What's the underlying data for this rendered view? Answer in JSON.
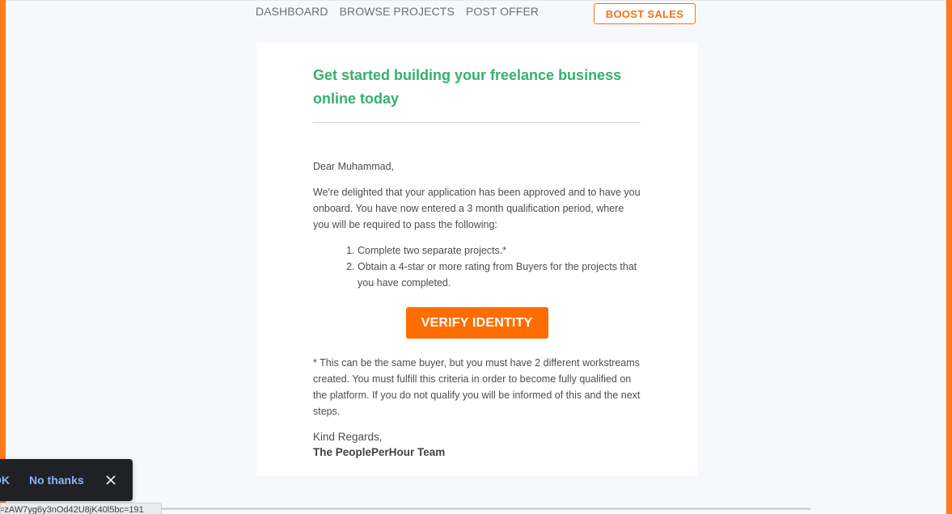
{
  "nav": {
    "items": [
      "DASHBOARD",
      "BROWSE PROJECTS",
      "POST OFFER"
    ],
    "boost_label": "BOOST SALES"
  },
  "email": {
    "headline": "Get started building your freelance business online today",
    "greeting": "Dear Muhammad,",
    "intro": "We're delighted that your application has been approved and to have you onboard. You have now entered a 3 month qualification period, where you will be required to pass the following:",
    "requirements": [
      "Complete two separate projects.*",
      "Obtain a 4-star or more rating from Buyers for the projects that you have completed."
    ],
    "cta_label": "VERIFY IDENTITY",
    "footnote": "* This can be the same buyer, but you must have 2 different workstreams created. You must fulfill this criteria in order to become fully qualified on the platform. If you do not qualify you will be informed of this and the next steps.",
    "signoff": "Kind Regards,",
    "signature": "The PeoplePerHour Team"
  },
  "toast": {
    "ok_label": "OK",
    "dismiss_label": "No thanks",
    "close_icon": "close-icon"
  },
  "status_bar": {
    "url_fragment": "=zAW7yg6y3nOd42U8jK40l5bc=191"
  },
  "colors": {
    "accent_orange": "#ff6d00",
    "headline_green": "#35b06b",
    "edge_orange": "#ff7a1a"
  }
}
